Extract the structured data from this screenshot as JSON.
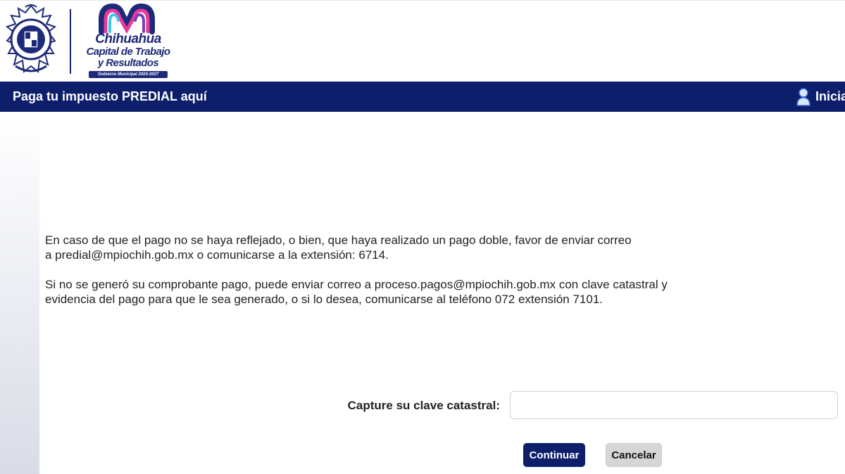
{
  "header": {
    "brand": {
      "line1": "Chihuahua",
      "line2": "Capital de Trabajo",
      "line3": "y Resultados",
      "tagline": "Gobierno Municipal 2024-2027"
    }
  },
  "navbar": {
    "title": "Paga tu impuesto PREDIAL aquí",
    "login_label": "Iniciar"
  },
  "main": {
    "paragraph1_line1": "En caso de que el pago no se haya reflejado, o bien, que haya realizado un pago doble, favor de enviar correo",
    "paragraph1_line2": "a predial@mpiochih.gob.mx o comunicarse a la extensión: 6714.",
    "paragraph2_line1": "Si no se generó su comprobante pago, puede enviar correo a proceso.pagos@mpiochih.gob.mx con clave catastral y",
    "paragraph2_line2": "evidencia del pago para que le sea generado, o si lo desea, comunicarse al teléfono 072 extensión 7101.",
    "field_label": "Capture su clave catastral:",
    "field_value": "",
    "continue_label": "Continuar",
    "cancel_label": "Cancelar"
  },
  "icons": {
    "coat_of_arms": "coat-of-arms-icon",
    "brand_wave": "brand-wave-icon",
    "user": "user-icon"
  },
  "colors": {
    "navbar": "#0d1f6b",
    "brand_text": "#1d2a7a",
    "continue_button": "#0d1f6b",
    "cancel_button": "#d6d6d6"
  }
}
